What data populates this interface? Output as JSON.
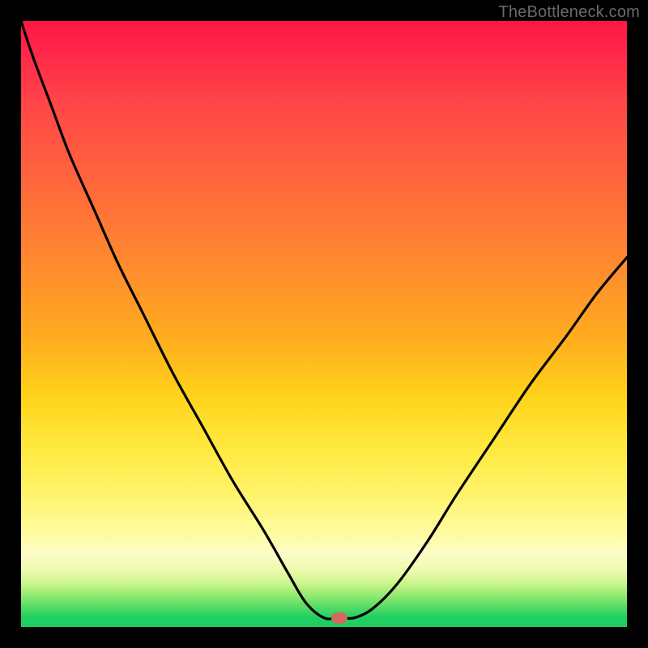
{
  "watermark": "TheBottleneck.com",
  "chart_data": {
    "type": "line",
    "title": "",
    "xlabel": "",
    "ylabel": "",
    "xlim": [
      0,
      1
    ],
    "ylim": [
      0,
      1
    ],
    "legend": false,
    "grid": false,
    "series": [
      {
        "name": "bottleneck-curve",
        "x": [
          0.0,
          0.02,
          0.05,
          0.08,
          0.12,
          0.16,
          0.2,
          0.25,
          0.3,
          0.35,
          0.4,
          0.44,
          0.47,
          0.5,
          0.525,
          0.55,
          0.58,
          0.62,
          0.67,
          0.72,
          0.78,
          0.84,
          0.9,
          0.95,
          1.0
        ],
        "values": [
          1.0,
          0.94,
          0.86,
          0.78,
          0.69,
          0.6,
          0.52,
          0.42,
          0.33,
          0.24,
          0.16,
          0.09,
          0.04,
          0.015,
          0.015,
          0.015,
          0.03,
          0.07,
          0.14,
          0.22,
          0.31,
          0.4,
          0.48,
          0.55,
          0.61
        ]
      }
    ],
    "annotations": [
      {
        "name": "optimum-marker",
        "x": 0.525,
        "y": 0.015,
        "shape": "oval",
        "color": "#d2695e"
      }
    ],
    "background_gradient": {
      "direction": "top-to-bottom",
      "stops": [
        {
          "pos": 0.0,
          "color": "#ff1744"
        },
        {
          "pos": 0.28,
          "color": "#ff6a3a"
        },
        {
          "pos": 0.62,
          "color": "#ffd31a"
        },
        {
          "pos": 0.88,
          "color": "#fdfcc8"
        },
        {
          "pos": 1.0,
          "color": "#1fcf63"
        }
      ]
    }
  },
  "colors": {
    "frame": "#000000",
    "curve": "#000000",
    "watermark": "#6a6a6a",
    "marker": "#d2695e"
  }
}
